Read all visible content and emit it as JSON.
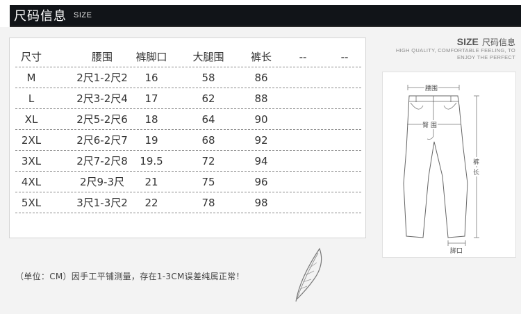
{
  "header": {
    "title": "尺码信息",
    "subtitle": "SIZE"
  },
  "table": {
    "columns": [
      "尺寸",
      "腰围",
      "裤脚口",
      "大腿围",
      "裤长",
      "--",
      "--"
    ],
    "rows": [
      [
        "M",
        "2尺1-2尺2",
        "16",
        "58",
        "86"
      ],
      [
        "L",
        "2尺3-2尺4",
        "17",
        "62",
        "88"
      ],
      [
        "XL",
        "2尺5-2尺6",
        "18",
        "64",
        "90"
      ],
      [
        "2XL",
        "2尺6-2尺7",
        "19",
        "68",
        "92"
      ],
      [
        "3XL",
        "2尺7-2尺8",
        "19.5",
        "72",
        "94"
      ],
      [
        "4XL",
        "2尺9-3尺",
        "21",
        "75",
        "96"
      ],
      [
        "5XL",
        "3尺1-3尺2",
        "22",
        "78",
        "98"
      ]
    ]
  },
  "figure": {
    "heading_en": "SIZE",
    "heading_cn": "尺码信息",
    "tagline_1": "HIGH QUALITY, COMFORTABLE FEELING, TO",
    "tagline_2": "ENJOY THE PERFECT",
    "label_waist": "腰围",
    "label_thigh": "臀 围",
    "label_length_1": "裤",
    "label_length_2": "长",
    "label_hem": "脚口"
  },
  "footnote": "（单位：CM）因手工平铺测量，存在1-3CM误差纯属正常！",
  "colors": {
    "header_bg": "#111418",
    "page_bg": "#f3f3f3",
    "card_bg": "#ffffff"
  }
}
